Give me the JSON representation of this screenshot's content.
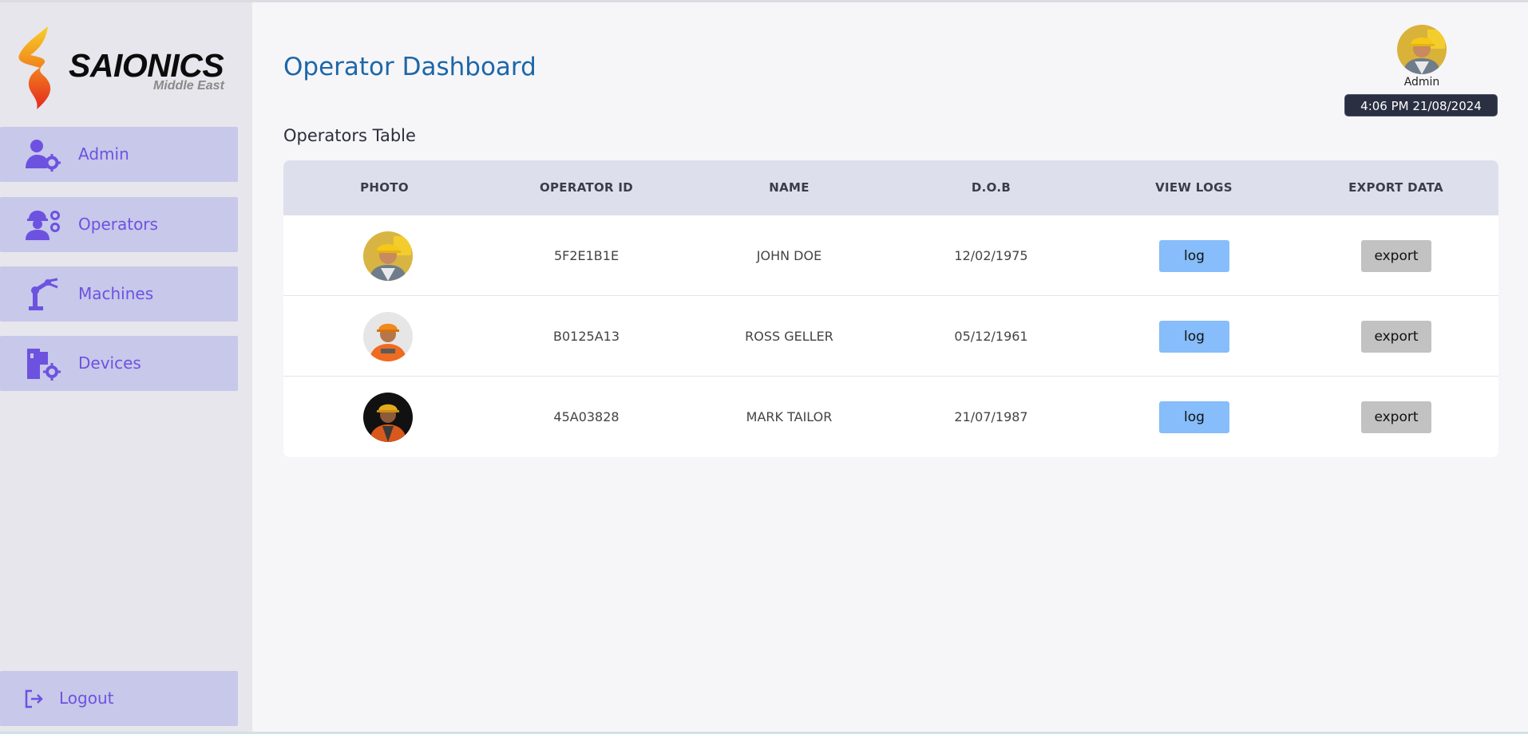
{
  "brand": {
    "name": "SAIONICS",
    "subtitle": "Middle East"
  },
  "sidebar": {
    "items": [
      {
        "label": "Admin",
        "icon": "admin-gear-icon"
      },
      {
        "label": "Operators",
        "icon": "operators-icon"
      },
      {
        "label": "Machines",
        "icon": "robot-arm-icon"
      },
      {
        "label": "Devices",
        "icon": "device-gear-icon"
      }
    ],
    "logout": {
      "label": "Logout",
      "icon": "logout-icon"
    }
  },
  "header": {
    "title": "Operator Dashboard",
    "user": {
      "name": "Admin",
      "avatar": "worker-avatar"
    },
    "clock": "4:06 PM  21/08/2024"
  },
  "table": {
    "title": "Operators Table",
    "columns": [
      "PHOTO",
      "OPERATOR ID",
      "NAME",
      "D.O.B",
      "VIEW LOGS",
      "EXPORT DATA"
    ],
    "rows": [
      {
        "photo": "worker-photo-1",
        "operator_id": "5F2E1B1E",
        "name": "JOHN DOE",
        "dob": "12/02/1975",
        "log_label": "log",
        "export_label": "export"
      },
      {
        "photo": "worker-photo-2",
        "operator_id": "B0125A13",
        "name": "ROSS GELLER",
        "dob": "05/12/1961",
        "log_label": "log",
        "export_label": "export"
      },
      {
        "photo": "worker-photo-3",
        "operator_id": "45A03828",
        "name": "MARK TAILOR",
        "dob": "21/07/1987",
        "log_label": "log",
        "export_label": "export"
      }
    ]
  },
  "colors": {
    "accent": "#6d52e0",
    "title": "#1d67a8",
    "nav_bg": "#c7c8ea",
    "log_button": "#86bdfa",
    "export_button": "#c2c2c2"
  }
}
